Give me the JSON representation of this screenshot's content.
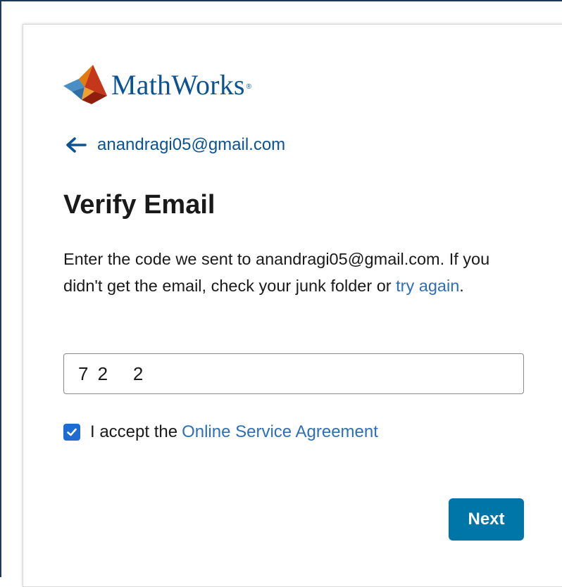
{
  "logo": {
    "brand_name": "MathWorks",
    "registered_mark": "®",
    "icon": "membrane-logo-icon"
  },
  "back": {
    "icon": "arrow-left-icon",
    "email": "anandragi05@gmail.com"
  },
  "page": {
    "title": "Verify Email",
    "description_prefix": "Enter the code we sent to anandragi05@gmail.com. If you didn't get the email, check your junk folder or ",
    "try_again_link": "try again",
    "description_suffix": "."
  },
  "code_field": {
    "value": "7 2   2"
  },
  "agreement": {
    "checked": true,
    "checkbox_icon": "checkmark-icon",
    "label": "I accept the",
    "link": "Online Service Agreement"
  },
  "actions": {
    "next_label": "Next"
  },
  "colors": {
    "brand_blue": "#0b5394",
    "link_blue": "#2e6fb7",
    "button_blue": "#0076a8",
    "checkbox_blue": "#1f6bd1",
    "text": "#1a1a1a"
  }
}
